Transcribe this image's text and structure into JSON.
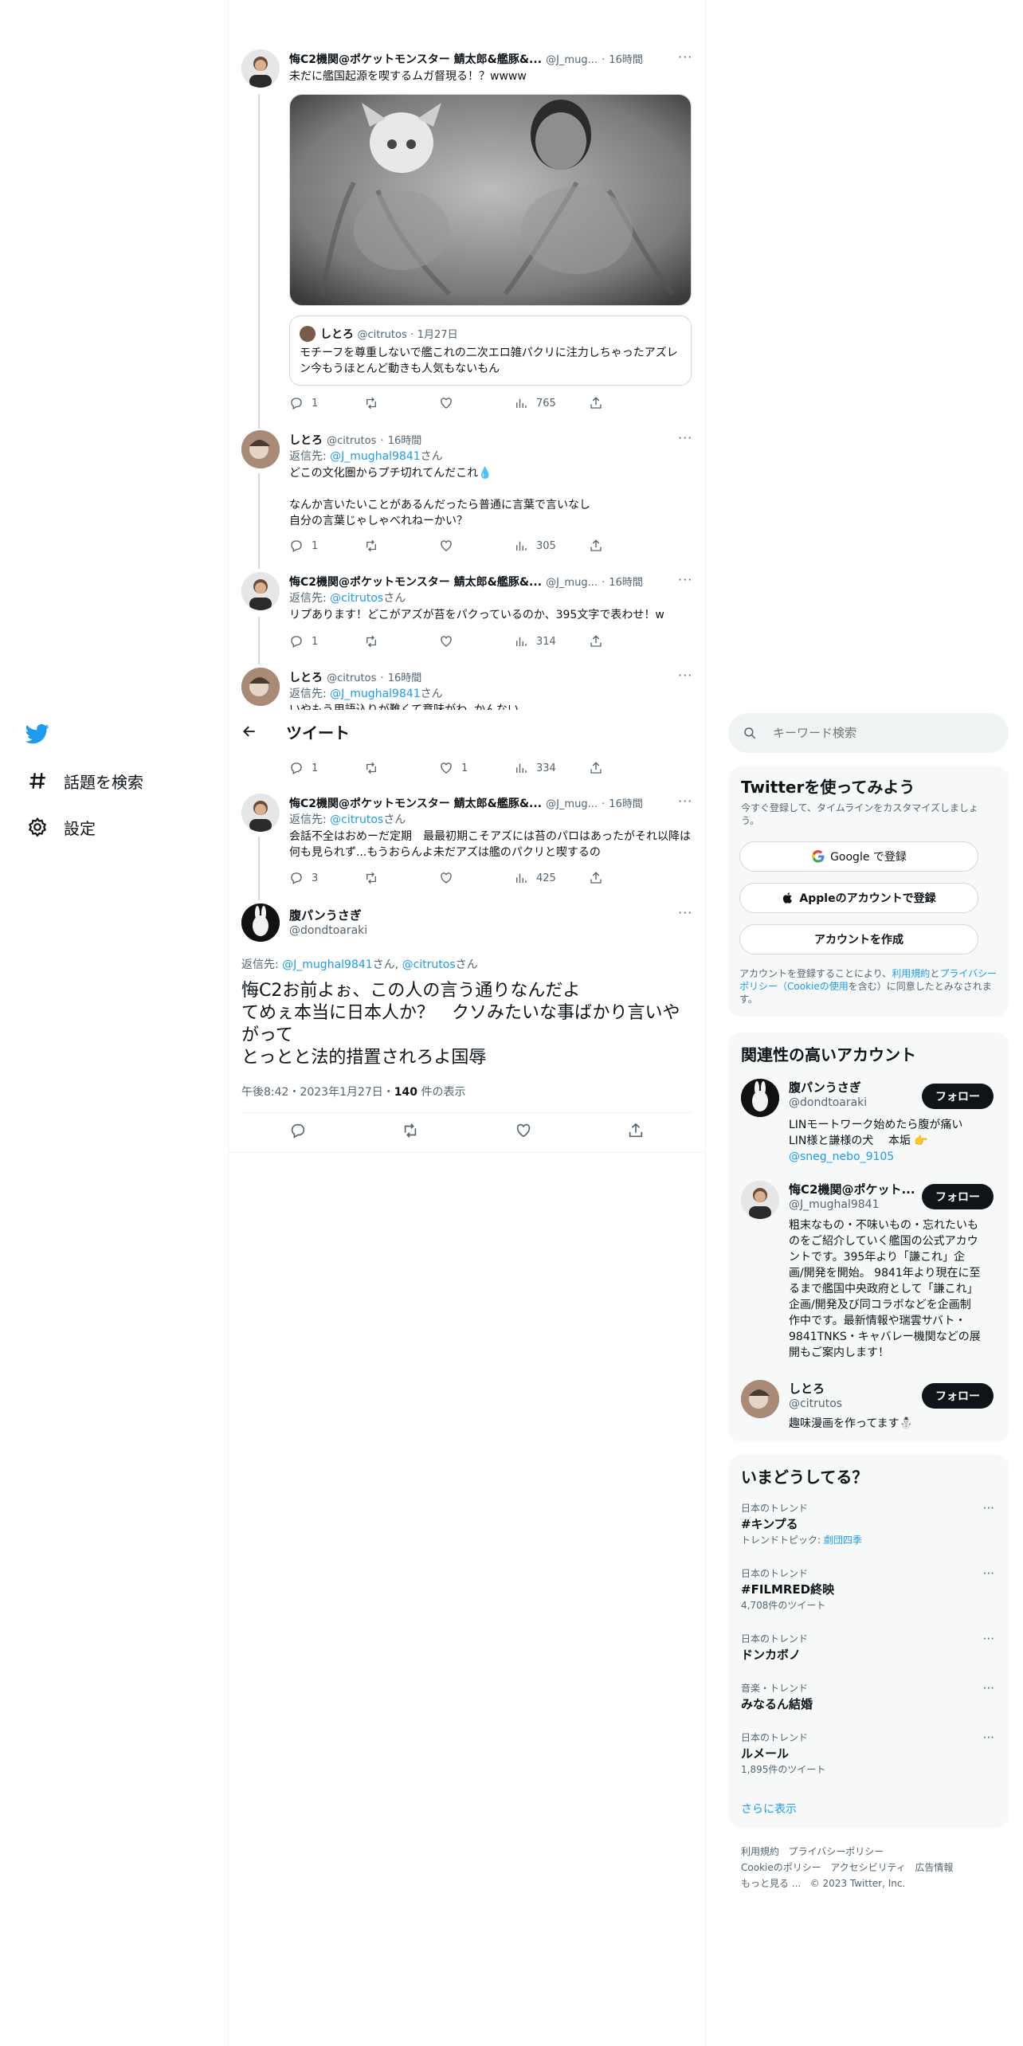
{
  "nav": {
    "explore": "話題を検索",
    "settings": "設定"
  },
  "thread": [
    {
      "name": "悔C2機関@ポケットモンスター 鯖太郎&艦豚&...",
      "handle": "@J_mug...",
      "time": "16時間",
      "text": "未だに艦国起源を喫するムガ督現る！？wwww",
      "quote": {
        "name": "しとろ",
        "handle": "@citrutos",
        "date": "1月27日",
        "text": "モチーフを尊重しないで艦これの二次エロ雑パクリに注力しちゃったアズレン今もうほとんど動きも人気もないもん"
      },
      "reply": "1",
      "views": "765"
    },
    {
      "name": "しとろ",
      "handle": "@citrutos",
      "time": "16時間",
      "reply_to_label": "返信先:",
      "reply_to": "@J_mughal9841",
      "reply_to_suffix": "さん",
      "text1": "どこの文化圏からプチ切れてんだこれ💧",
      "text2": "なんか言いたいことがあるんだったら普通に言葉で言いなし",
      "text3": "自分の言葉じゃしゃべれねーかい？",
      "reply": "1",
      "views": "305"
    },
    {
      "name": "悔C2機関@ポケットモンスター 鯖太郎&艦豚&...",
      "handle": "@J_mug...",
      "time": "16時間",
      "reply_to_label": "返信先:",
      "reply_to": "@citrutos",
      "reply_to_suffix": "さん",
      "text": "リプあります！どこがアズが苔をパクっているのか、395文字で表わせ！w",
      "reply": "1",
      "views": "314"
    },
    {
      "name": "しとろ",
      "handle": "@citrutos",
      "time": "16時間",
      "reply_to_label": "返信先:",
      "reply_to": "@J_mughal9841",
      "reply_to_suffix": "さん",
      "text": "いやもう用語込りが難くて意味がわ..かんない"
    }
  ],
  "header": {
    "title": "ツイート"
  },
  "partial_actions": {
    "reply": "1",
    "likes": "1",
    "views": "334"
  },
  "thread2": {
    "name": "悔C2機関@ポケットモンスター 鯖太郎&艦豚&...",
    "handle": "@J_mug...",
    "time": "16時間",
    "reply_to_label": "返信先:",
    "reply_to": "@citrutos",
    "reply_to_suffix": "さん",
    "text": "会話不全はおめーだ定期　最最初期こそアズには苔のパロはあったがそれ以降は何も見られず...もうおらんよ未だアズは艦のパクリと喫するの",
    "reply": "3",
    "views": "425"
  },
  "main": {
    "name": "腹パンうさぎ",
    "handle": "@dondtoaraki",
    "reply_to_label": "返信先:",
    "reply_to_1": "@J_mughal9841",
    "reply_to_mid": "さん,",
    "reply_to_2": "@citrutos",
    "reply_to_suffix": "さん",
    "line1": "悔C2お前よぉ、この人の言う通りなんだよ",
    "line2": "てめぇ本当に日本人か？　クソみたいな事ばかり言いやがって",
    "line3": "とっとと法的措置されろよ国辱",
    "time": "午後8:42・2023年1月27日・",
    "views_count": "140",
    "views_label": "件の表示"
  },
  "search": {
    "placeholder": "キーワード検索"
  },
  "signup": {
    "title": "Twitterを使ってみよう",
    "subtitle": "今すぐ登録して、タイムラインをカスタマイズしましょう。",
    "google": "Google で登録",
    "apple": "Appleのアカウントで登録",
    "create": "アカウントを作成",
    "terms_prefix": "アカウントを登録することにより、",
    "terms_link": "利用規約",
    "terms_and": "と",
    "privacy_link": "プライバシーポリシー（Cookieの使用",
    "terms_suffix": "を含む）に同意したとみなされます。"
  },
  "related": {
    "title": "関連性の高いアカウント",
    "follow": "フォロー",
    "accounts": [
      {
        "name": "腹パンうさぎ",
        "handle": "@dondtoaraki",
        "bio1": "LINモートワーク始めたら腹が痛い",
        "bio2": "LIN様と謙様の犬　 本垢 👉",
        "bio_link": "@sneg_nebo_9105"
      },
      {
        "name": "悔C2機関@ポケット...",
        "handle": "@J_mughal9841",
        "bio": [
          "粗末なもの・不味いもの・忘れたいも",
          "のをご紹介していく艦国の公式アカウ",
          "ントです。395年より「謙これ」企",
          "画/開発を開始。 9841年より現在に至",
          "るまで艦国中央政府として「謙これ」",
          "企画/開発及び同コラボなどを企画制",
          "作中です。最新情報や瑞雲サバト・",
          "9841TNKS・キャバレー機関などの展",
          "開もご案内します！"
        ]
      },
      {
        "name": "しとろ",
        "handle": "@citrutos",
        "bio1": "趣味漫画を作ってます⛄"
      }
    ]
  },
  "trends": {
    "title": "いまどうしてる？",
    "items": [
      {
        "context": "日本のトレンド",
        "name": "#キンプる",
        "meta_prefix": "トレンドトピック:",
        "meta_link": "劇団四季"
      },
      {
        "context": "日本のトレンド",
        "name": "#FILMRED終映",
        "meta": "4,708件のツイート"
      },
      {
        "context": "日本のトレンド",
        "name": "ドンカボノ"
      },
      {
        "context": "音楽・トレンド",
        "name": "みなるん結婚"
      },
      {
        "context": "日本のトレンド",
        "name": "ルメール",
        "meta": "1,895件のツイート"
      }
    ],
    "show_more": "さらに表示"
  },
  "footer": {
    "l1a": "利用規約",
    "l1b": "プライバシーポリシー",
    "l2a": "Cookieのポリシー",
    "l2b": "アクセシビリティ",
    "l2c": "広告情報",
    "l3a": "もっと見る ...",
    "l3b": "© 2023 Twitter, Inc."
  },
  "colors": {
    "accent": "#1d9bf0",
    "text": "#0f1419",
    "muted": "#536471"
  }
}
